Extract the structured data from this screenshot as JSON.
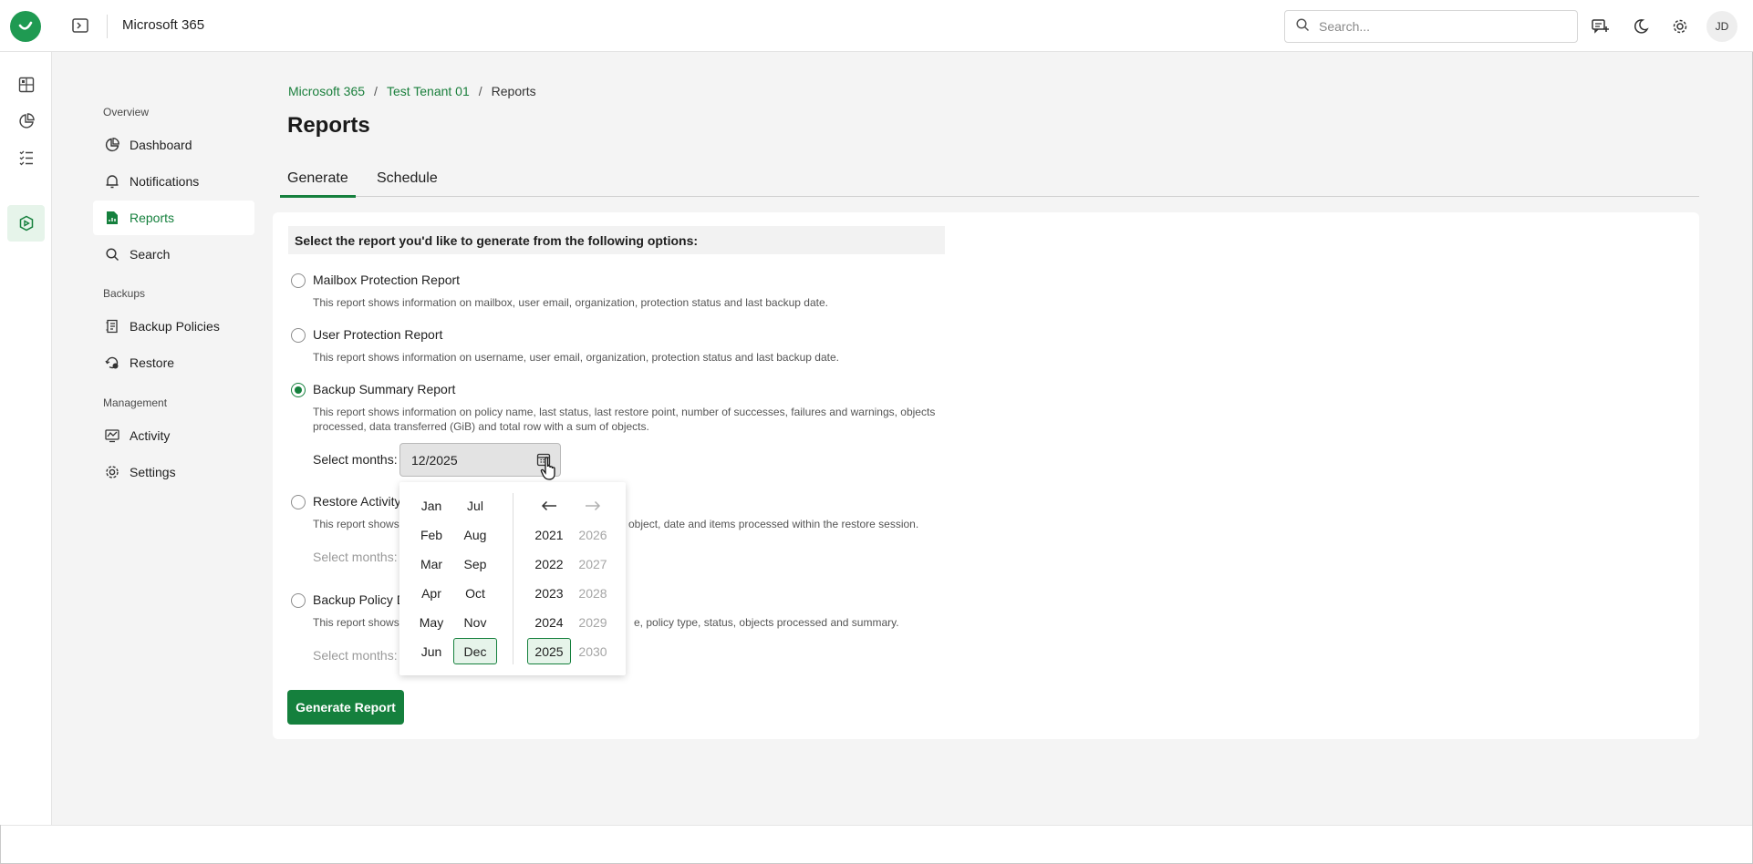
{
  "app": {
    "title": "Microsoft 365"
  },
  "search": {
    "placeholder": "Search..."
  },
  "user": {
    "initials": "JD"
  },
  "icons": {
    "logo": "checkmark-logo-icon",
    "panel_toggle": "panel-toggle-icon",
    "top": [
      "search-icon",
      "chat-plus-icon",
      "moon-icon",
      "gear-icon"
    ],
    "rail": [
      "grid-icon",
      "pie-chart-icon",
      "checklist-icon",
      "m365-product-icon"
    ]
  },
  "colors": {
    "accent": "#15803d",
    "accent_light": "#e6f4ea",
    "brand": "#1f9a52"
  },
  "sidebar": {
    "sections": [
      {
        "title": "Overview",
        "items": [
          {
            "label": "Dashboard",
            "icon": "pie-chart-icon"
          },
          {
            "label": "Notifications",
            "icon": "bell-icon"
          },
          {
            "label": "Reports",
            "icon": "report-icon",
            "active": true
          },
          {
            "label": "Search",
            "icon": "search-icon"
          }
        ]
      },
      {
        "title": "Backups",
        "items": [
          {
            "label": "Backup Policies",
            "icon": "policy-icon"
          },
          {
            "label": "Restore",
            "icon": "restore-icon"
          }
        ]
      },
      {
        "title": "Management",
        "items": [
          {
            "label": "Activity",
            "icon": "activity-icon"
          },
          {
            "label": "Settings",
            "icon": "gear-icon"
          }
        ]
      }
    ]
  },
  "breadcrumb": [
    "Microsoft 365",
    "Test Tenant 01",
    "Reports"
  ],
  "page": {
    "title": "Reports"
  },
  "tabs": [
    {
      "label": "Generate",
      "active": true
    },
    {
      "label": "Schedule"
    }
  ],
  "form": {
    "header": "Select the report you'd like to generate from the following options:",
    "options": [
      {
        "label": "Mailbox Protection Report",
        "desc": "This report shows information on mailbox, user email, organization, protection status and last backup date.",
        "checked": false
      },
      {
        "label": "User Protection Report",
        "desc": "This report shows information on username, user email, organization, protection status and last backup date.",
        "checked": false
      },
      {
        "label": "Backup Summary Report",
        "desc_line1": "This report shows information on policy name, last status, last restore point, number of successes, failures and warnings, objects",
        "desc_line2": "processed, data transferred (GiB) and total row with a sum of objects.",
        "checked": true
      },
      {
        "label": "Restore Activity",
        "desc": "This report shows",
        "desc_tail": "object, date and items processed within the restore session.",
        "checked": false
      },
      {
        "label": "Backup Policy D",
        "desc": "This report shows",
        "desc_tail": "e, policy type, status, objects processed and summary.",
        "checked": false
      }
    ],
    "select_months_label": "Select months:",
    "month_value": "12/2025",
    "generate_label": "Generate Report"
  },
  "picker": {
    "months_col1": [
      "Jan",
      "Feb",
      "Mar",
      "Apr",
      "May",
      "Jun"
    ],
    "months_col2": [
      "Jul",
      "Aug",
      "Sep",
      "Oct",
      "Nov",
      "Dec"
    ],
    "years_col1": [
      "2021",
      "2022",
      "2023",
      "2024",
      "2025"
    ],
    "years_col2": [
      "2026",
      "2027",
      "2028",
      "2029",
      "2030"
    ],
    "selected_month": "Dec",
    "selected_year": "2025"
  }
}
